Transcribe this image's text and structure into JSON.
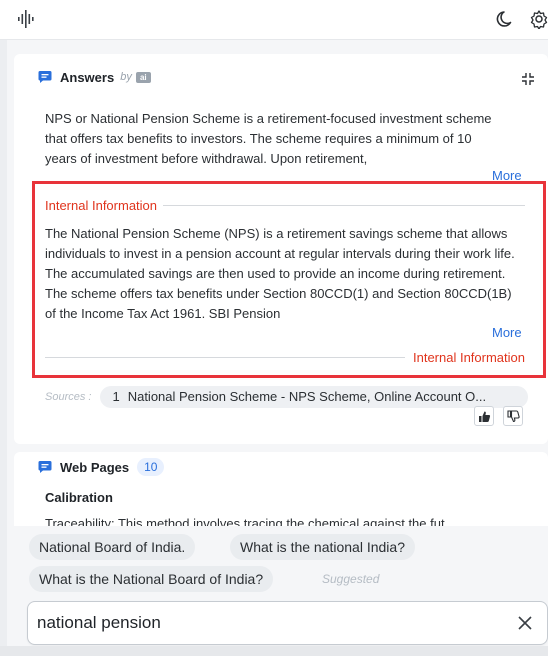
{
  "topbar": {
    "icons": [
      "audio-wave-icon",
      "moon-icon",
      "gear-icon"
    ]
  },
  "answers": {
    "title": "Answers",
    "by": "by",
    "badge": "ai",
    "text": "NPS or National Pension Scheme is a retirement-focused investment scheme that offers tax benefits to investors. The scheme requires a minimum of 10 years of investment before withdrawal. Upon retirement,",
    "more": "More",
    "internal": {
      "label_top": "Internal Information",
      "text": "The National Pension Scheme (NPS) is a retirement savings scheme that allows individuals to invest in a pension account at regular intervals during their work life. The accumulated savings are then used to provide an income during retirement. The scheme offers tax benefits under Section 80CCD(1) and Section 80CCD(1B) of the Income Tax Act 1961. SBI Pension",
      "more": "More",
      "label_bottom": "Internal Information",
      "highlight_color": "#e8333a"
    },
    "sources_label": "Sources :",
    "source": {
      "num": "1",
      "title": "National Pension Scheme - NPS Scheme, Online Account O..."
    }
  },
  "web_pages": {
    "title": "Web Pages",
    "count": "10",
    "subtitle": "Calibration",
    "truncated": "Traceability: This method involves tracing the chemical against the fut..."
  },
  "suggestions": {
    "chips": [
      "National Board of India.",
      "What is the national India?",
      "What is the National Board of India?"
    ],
    "suggested_label": "Suggested"
  },
  "search": {
    "value": "national pension",
    "placeholder": ""
  },
  "colors": {
    "accent": "#2a6fdb",
    "internal_label": "#e0341d",
    "highlight_border": "#e8333a"
  }
}
